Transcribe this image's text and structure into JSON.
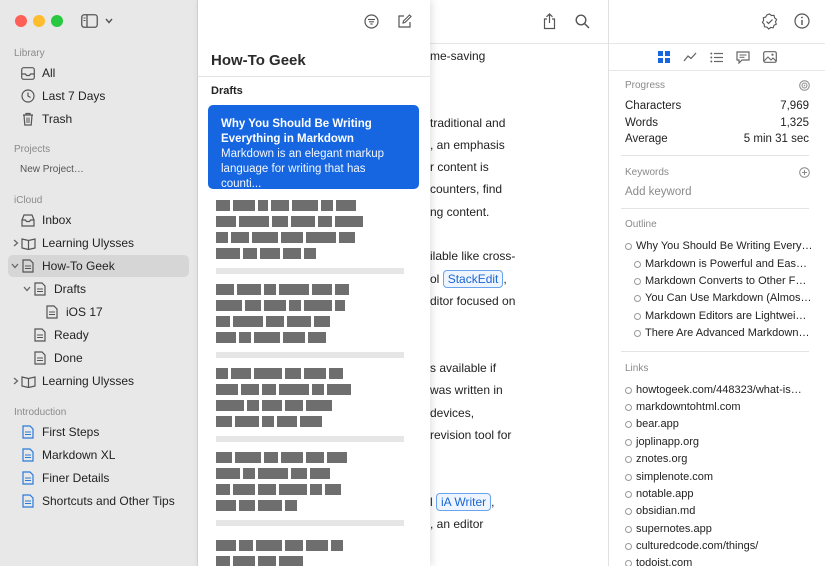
{
  "colors": {
    "accent": "#1566e0",
    "close": "#fe5f57",
    "minimize": "#febc2e",
    "zoom": "#28c840"
  },
  "sidebar": {
    "library_title": "Library",
    "library": [
      {
        "label": "All",
        "icon": "tray-icon"
      },
      {
        "label": "Last 7 Days",
        "icon": "clock-icon"
      },
      {
        "label": "Trash",
        "icon": "trash-icon"
      }
    ],
    "projects_title": "Projects",
    "new_project": "New Project…",
    "icloud_title": "iCloud",
    "icloud": [
      {
        "label": "Inbox",
        "icon": "inbox-icon"
      },
      {
        "label": "Learning Ulysses",
        "icon": "group-icon"
      },
      {
        "label": "How-To Geek",
        "icon": "sheet-icon"
      },
      {
        "label": "Drafts",
        "icon": "sheet-icon"
      },
      {
        "label": "iOS 17",
        "icon": "sheet-icon"
      },
      {
        "label": "Ready",
        "icon": "sheet-icon"
      },
      {
        "label": "Done",
        "icon": "sheet-icon"
      },
      {
        "label": "Learning Ulysses",
        "icon": "group-icon"
      }
    ],
    "intro_title": "Introduction",
    "intro": [
      {
        "label": "First Steps"
      },
      {
        "label": "Markdown XL"
      },
      {
        "label": "Finer Details"
      },
      {
        "label": "Shortcuts and Other Tips"
      }
    ]
  },
  "sheetlist": {
    "title": "How-To Geek",
    "subtitle": "Drafts",
    "selected": {
      "title": "Why You Should Be Writing Everything in Markdown",
      "preview": "Markdown is an elegant markup language for writing that has counti..."
    }
  },
  "editor": {
    "lines": [
      "me-saving",
      "traditional and",
      ", an emphasis",
      "r content is",
      " counters, find",
      "ng content.",
      "ilable like cross-",
      "ol ",
      "ditor focused on",
      "s available if",
      "was written in",
      " devices,",
      "revision tool for",
      "l ",
      ", an editor"
    ],
    "link1": "StackEdit",
    "link1_after": ",",
    "link2": "iA Writer",
    "link2_after": ","
  },
  "inspector": {
    "progress_title": "Progress",
    "stats": [
      {
        "label": "Characters",
        "value": "7,969"
      },
      {
        "label": "Words",
        "value": "1,325"
      },
      {
        "label": "Average",
        "value": "5 min 31 sec"
      }
    ],
    "keywords_title": "Keywords",
    "add_keyword": "Add keyword",
    "outline_title": "Outline",
    "outline": [
      {
        "text": "Why You Should Be Writing Every…",
        "level": 0
      },
      {
        "text": "Markdown is Powerful and Eas…",
        "level": 1
      },
      {
        "text": "Markdown Converts to Other F…",
        "level": 1
      },
      {
        "text": "You Can Use Markdown (Almos…",
        "level": 1
      },
      {
        "text": "Markdown Editors are Lightwei…",
        "level": 1
      },
      {
        "text": "There Are Advanced Markdown…",
        "level": 1
      }
    ],
    "links_title": "Links",
    "links": [
      "howtogeek.com/448323/what-is…",
      "markdowntohtml.com",
      "bear.app",
      "joplinapp.org",
      "znotes.org",
      "simplenote.com",
      "notable.app",
      "obsidian.md",
      "supernotes.app",
      "culturedcode.com/things/",
      "todoist.com"
    ]
  }
}
